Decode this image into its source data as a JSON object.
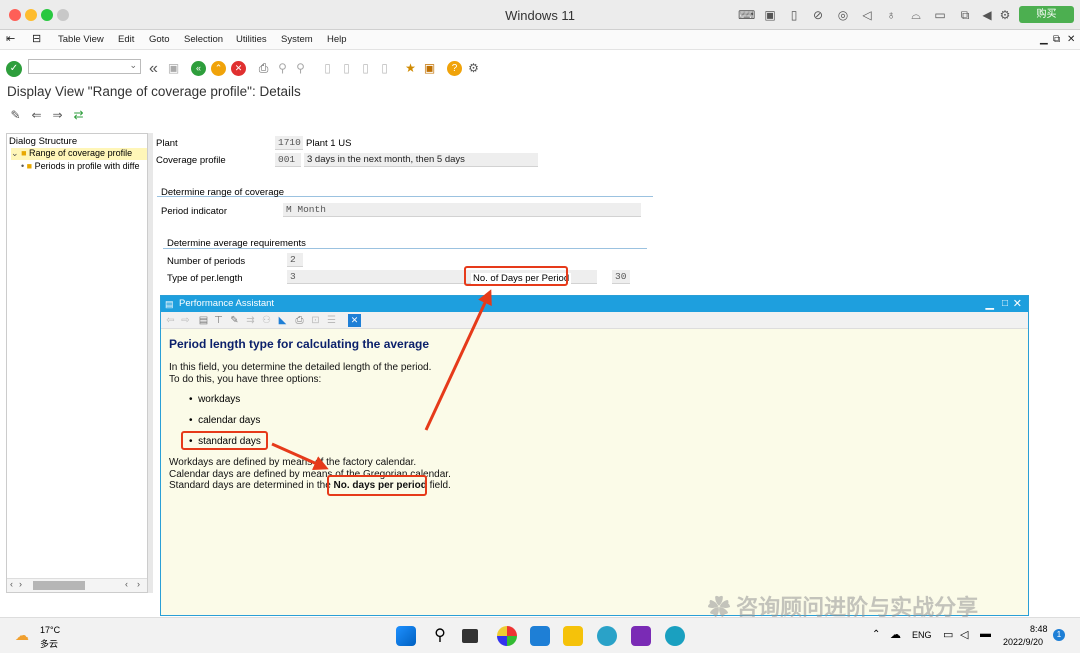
{
  "mac": {
    "window_title": "Windows 11",
    "buy_label": "购买",
    "colors": {
      "close": "#fe5f57",
      "minimize": "#febc2e",
      "maximize": "#28c840"
    }
  },
  "menu": {
    "items": [
      "Table View",
      "Edit",
      "Goto",
      "Selection",
      "Utilities",
      "System",
      "Help"
    ]
  },
  "page": {
    "title": "Display View \"Range of coverage profile\": Details"
  },
  "tree": {
    "header": "Dialog Structure",
    "items": [
      {
        "label": "Range of coverage profile",
        "selected": true
      },
      {
        "label": "Periods in profile with diffe",
        "selected": false
      }
    ]
  },
  "form": {
    "plant_label": "Plant",
    "plant_value": "1710",
    "plant_desc": "Plant 1 US",
    "coverage_label": "Coverage profile",
    "coverage_value": "001",
    "coverage_desc": "3 days in the next month, then 5 days",
    "group1_title": "Determine range of coverage",
    "period_indicator_label": "Period indicator",
    "period_indicator_value": "M  Month",
    "group2_title": "Determine average requirements",
    "num_periods_label": "Number of periods",
    "num_periods_value": "2",
    "type_length_label": "Type of per.length",
    "type_length_value": "3",
    "days_per_period_label": "No. of Days per Period",
    "days_per_period_value": "30"
  },
  "assistant": {
    "header": "Performance Assistant",
    "title": "Period length type for calculating the average",
    "intro1": "In this field, you determine the detailed length of the period.",
    "intro2": "To do this, you have three options:",
    "options": [
      "workdays",
      "calendar days",
      "standard days"
    ],
    "line1": "Workdays are defined by means of the factory calendar.",
    "line2": "Calendar days are defined by means of the Gregorian calendar.",
    "line3_pre": "Standard days are determined in the ",
    "line3_bold": "No. days per period",
    "line3_post": " field."
  },
  "watermark": "咨询顾问进阶与实战分享",
  "taskbar": {
    "temp": "17°C",
    "weather": "多云",
    "lang": "ENG",
    "time": "8:48",
    "date": "2022/9/20",
    "notif": "1"
  },
  "accent": "#e63a1a"
}
